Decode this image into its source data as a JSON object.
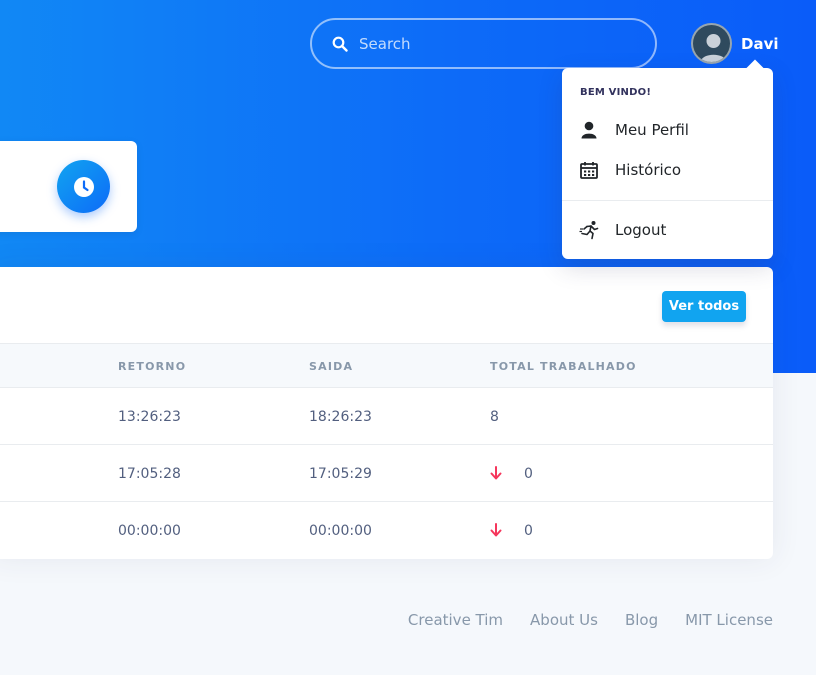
{
  "header": {
    "search": {
      "placeholder": "Search",
      "value": ""
    },
    "user": {
      "name": "Davi"
    }
  },
  "dropdown": {
    "header": "BEM VINDO!",
    "items": [
      {
        "label": "Meu Perfil",
        "icon": "user-icon"
      },
      {
        "label": "Histórico",
        "icon": "calendar-icon"
      },
      {
        "label": "Logout",
        "icon": "running-icon"
      }
    ]
  },
  "card": {
    "button": "Ver todos",
    "columns": [
      "RETORNO",
      "SAIDA",
      "TOTAL TRABALHADO"
    ],
    "rows": [
      {
        "retorno": "13:26:23",
        "saida": "18:26:23",
        "total": "8",
        "down": false
      },
      {
        "retorno": "17:05:28",
        "saida": "17:05:29",
        "total": "0",
        "down": true
      },
      {
        "retorno": "00:00:00",
        "saida": "00:00:00",
        "total": "0",
        "down": true
      }
    ]
  },
  "footer": {
    "links": [
      "Creative Tim",
      "About Us",
      "Blog",
      "MIT License"
    ]
  },
  "colors": {
    "primary": "#0d6bf8",
    "info": "#11a4f0",
    "danger": "#f5365c"
  }
}
